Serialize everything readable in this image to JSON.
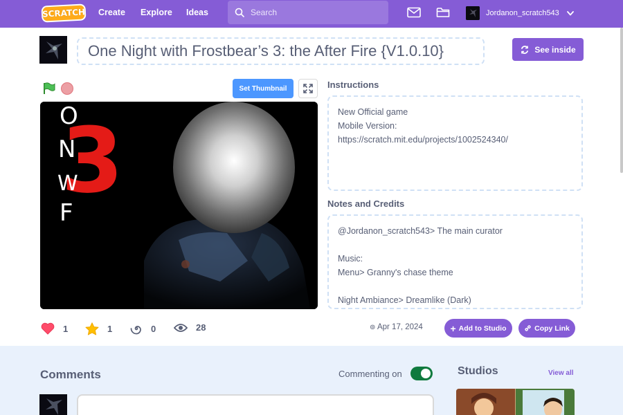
{
  "nav": {
    "logo_text": "SCRATCH",
    "links": [
      "Create",
      "Explore",
      "Ideas"
    ],
    "search_placeholder": "Search",
    "username": "Jordanon_scratch543",
    "bg_color": "#855cd6"
  },
  "project": {
    "title": "One Night with Frostbear’s 3: the After Fire {V1.0.10}",
    "see_inside_label": "See inside",
    "set_thumbnail_label": "Set Thumbnail",
    "stage_letters": [
      "O",
      "N",
      "W",
      "F"
    ],
    "stage_number": "3"
  },
  "stats": {
    "loves": "1",
    "favorites": "1",
    "remixes": "0",
    "views": "28"
  },
  "date": "Apr 17, 2024",
  "actions": {
    "add_to_studio_label": "Add to Studio",
    "copy_link_label": "Copy Link"
  },
  "instructions": {
    "heading": "Instructions",
    "text": "New Official game\nMobile Version:\nhttps://scratch.mit.edu/projects/1002524340/"
  },
  "notes": {
    "heading": "Notes and Credits",
    "text": "@Jordanon_scratch543> The main curator\n\nMusic:\nMenu> Granny's chase theme\n\nNight Ambiance> Dreamlike (Dark)"
  },
  "comments": {
    "heading": "Comments",
    "commenting_label": "Commenting on",
    "commenting_enabled": true
  },
  "studios": {
    "heading": "Studios",
    "view_all_label": "View all"
  },
  "icons": {
    "search": "search-icon",
    "messages": "envelope-icon",
    "my_stuff": "folder-icon",
    "see_inside": "remix-arrows-icon",
    "flag": "green-flag-icon",
    "stop": "stop-icon",
    "fullscreen": "fullscreen-icon",
    "love": "heart-icon",
    "favorite": "star-icon",
    "remix": "remix-spiral-icon",
    "views": "eye-icon"
  }
}
